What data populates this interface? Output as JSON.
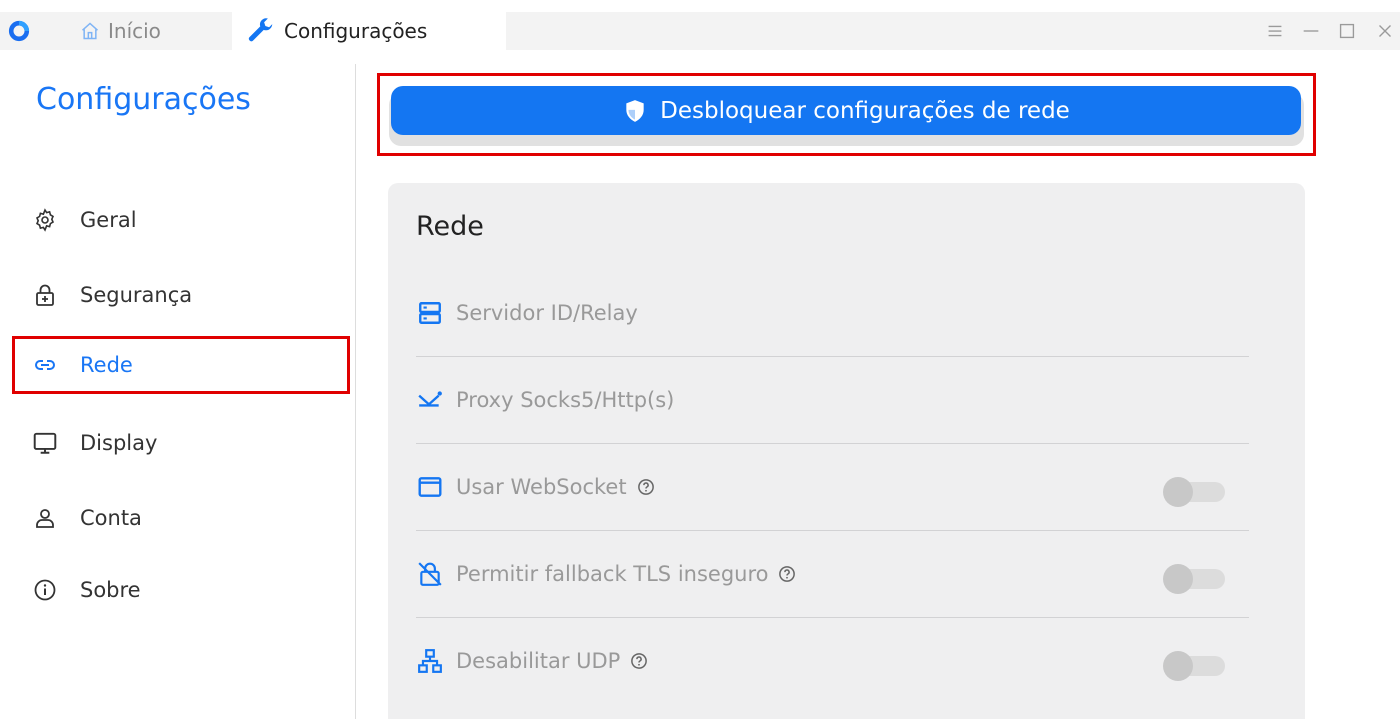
{
  "titlebar": {
    "tabs": [
      {
        "label": "Início",
        "icon": "home-icon"
      },
      {
        "label": "Configurações",
        "icon": "wrench-icon"
      }
    ],
    "controls": [
      "menu-icon",
      "minimize-icon",
      "maximize-icon",
      "close-icon"
    ]
  },
  "sidebar": {
    "title": "Configurações",
    "items": [
      {
        "label": "Geral",
        "icon": "gear-icon"
      },
      {
        "label": "Segurança",
        "icon": "lock-icon"
      },
      {
        "label": "Rede",
        "icon": "link-icon",
        "active": true
      },
      {
        "label": "Display",
        "icon": "monitor-icon"
      },
      {
        "label": "Conta",
        "icon": "user-icon"
      },
      {
        "label": "Sobre",
        "icon": "info-icon"
      }
    ]
  },
  "main": {
    "unlock_label": "Desbloquear configurações de rede",
    "card_title": "Rede",
    "rows": [
      {
        "label": "Servidor ID/Relay",
        "icon": "server-icon"
      },
      {
        "label": "Proxy Socks5/Http(s)",
        "icon": "proxy-icon"
      },
      {
        "label": "Usar WebSocket",
        "icon": "window-icon",
        "help": true,
        "toggle": false
      },
      {
        "label": "Permitir fallback TLS inseguro",
        "icon": "lock-off-icon",
        "help": true,
        "toggle": false
      },
      {
        "label": "Desabilitar UDP",
        "icon": "network-icon",
        "help": true,
        "toggle": false
      }
    ]
  },
  "colors": {
    "accent": "#1976f5",
    "button": "#1476f2",
    "highlight": "#e00000",
    "card_bg": "#efeff0"
  }
}
